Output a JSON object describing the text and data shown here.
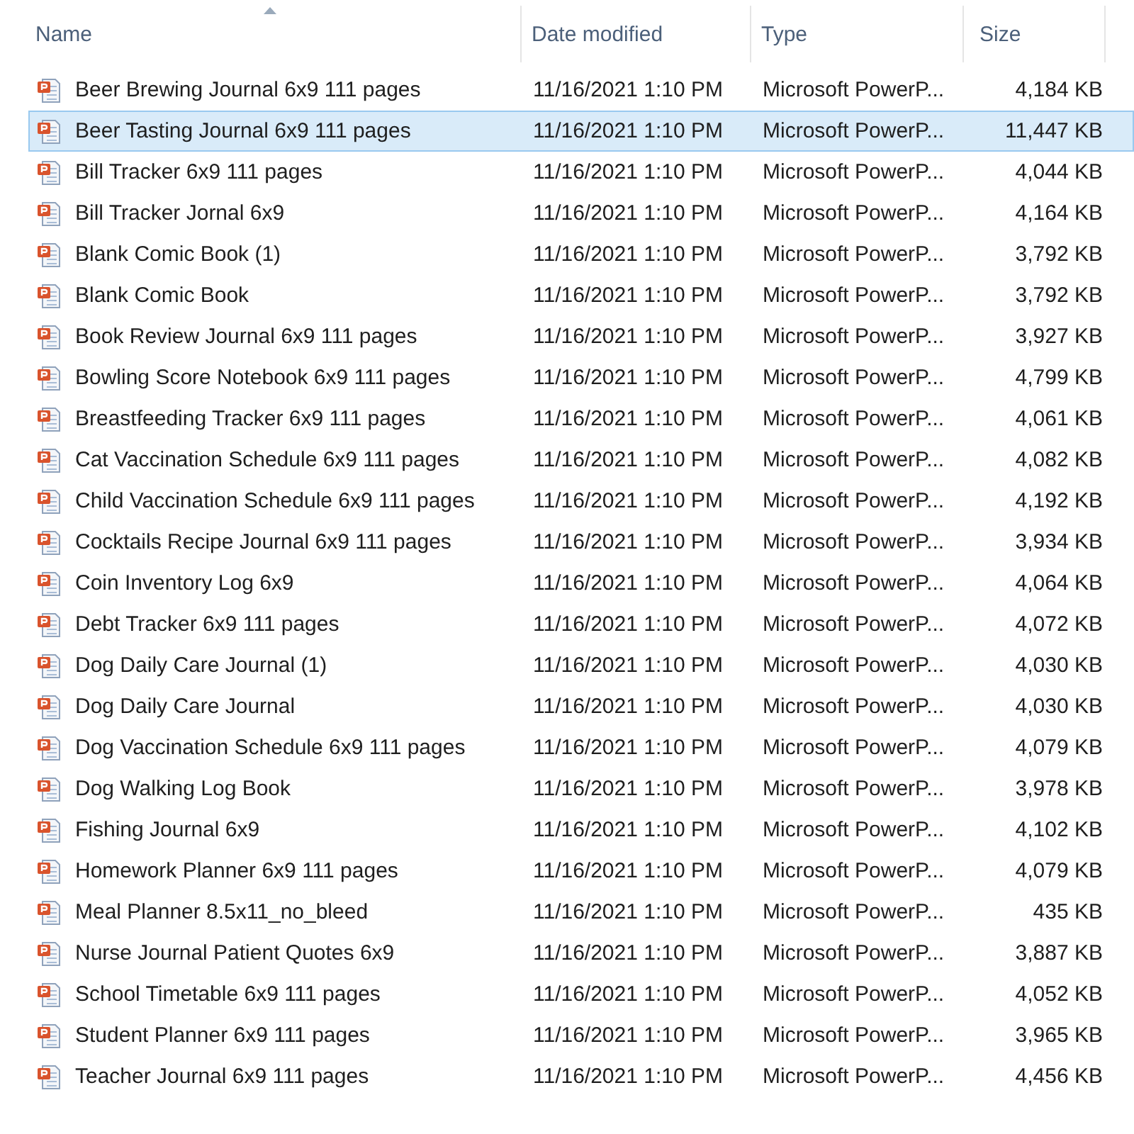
{
  "columns": [
    {
      "label": "Name",
      "sorted": true
    },
    {
      "label": "Date modified",
      "sorted": false
    },
    {
      "label": "Type",
      "sorted": false
    },
    {
      "label": "Size",
      "sorted": false
    }
  ],
  "rows": [
    {
      "name": "Beer Brewing Journal 6x9 111 pages",
      "date": "11/16/2021 1:10 PM",
      "type": "Microsoft PowerP...",
      "size": "4,184 KB",
      "selected": false
    },
    {
      "name": "Beer Tasting Journal 6x9 111 pages",
      "date": "11/16/2021 1:10 PM",
      "type": "Microsoft PowerP...",
      "size": "11,447 KB",
      "selected": true
    },
    {
      "name": "Bill Tracker 6x9 111 pages",
      "date": "11/16/2021 1:10 PM",
      "type": "Microsoft PowerP...",
      "size": "4,044 KB",
      "selected": false
    },
    {
      "name": "Bill Tracker Jornal 6x9",
      "date": "11/16/2021 1:10 PM",
      "type": "Microsoft PowerP...",
      "size": "4,164 KB",
      "selected": false
    },
    {
      "name": "Blank Comic Book (1)",
      "date": "11/16/2021 1:10 PM",
      "type": "Microsoft PowerP...",
      "size": "3,792 KB",
      "selected": false
    },
    {
      "name": "Blank Comic Book",
      "date": "11/16/2021 1:10 PM",
      "type": "Microsoft PowerP...",
      "size": "3,792 KB",
      "selected": false
    },
    {
      "name": "Book Review Journal 6x9 111 pages",
      "date": "11/16/2021 1:10 PM",
      "type": "Microsoft PowerP...",
      "size": "3,927 KB",
      "selected": false
    },
    {
      "name": "Bowling Score Notebook 6x9 111 pages",
      "date": "11/16/2021 1:10 PM",
      "type": "Microsoft PowerP...",
      "size": "4,799 KB",
      "selected": false
    },
    {
      "name": "Breastfeeding Tracker 6x9 111 pages",
      "date": "11/16/2021 1:10 PM",
      "type": "Microsoft PowerP...",
      "size": "4,061 KB",
      "selected": false
    },
    {
      "name": "Cat Vaccination Schedule 6x9 111 pages",
      "date": "11/16/2021 1:10 PM",
      "type": "Microsoft PowerP...",
      "size": "4,082 KB",
      "selected": false
    },
    {
      "name": "Child Vaccination Schedule 6x9 111 pages",
      "date": "11/16/2021 1:10 PM",
      "type": "Microsoft PowerP...",
      "size": "4,192 KB",
      "selected": false
    },
    {
      "name": "Cocktails Recipe Journal 6x9 111 pages",
      "date": "11/16/2021 1:10 PM",
      "type": "Microsoft PowerP...",
      "size": "3,934 KB",
      "selected": false
    },
    {
      "name": "Coin Inventory Log 6x9",
      "date": "11/16/2021 1:10 PM",
      "type": "Microsoft PowerP...",
      "size": "4,064 KB",
      "selected": false
    },
    {
      "name": "Debt Tracker 6x9 111 pages",
      "date": "11/16/2021 1:10 PM",
      "type": "Microsoft PowerP...",
      "size": "4,072 KB",
      "selected": false
    },
    {
      "name": "Dog Daily Care Journal (1)",
      "date": "11/16/2021 1:10 PM",
      "type": "Microsoft PowerP...",
      "size": "4,030 KB",
      "selected": false
    },
    {
      "name": "Dog Daily Care Journal",
      "date": "11/16/2021 1:10 PM",
      "type": "Microsoft PowerP...",
      "size": "4,030 KB",
      "selected": false
    },
    {
      "name": "Dog Vaccination Schedule 6x9 111 pages",
      "date": "11/16/2021 1:10 PM",
      "type": "Microsoft PowerP...",
      "size": "4,079 KB",
      "selected": false
    },
    {
      "name": "Dog Walking Log Book",
      "date": "11/16/2021 1:10 PM",
      "type": "Microsoft PowerP...",
      "size": "3,978 KB",
      "selected": false
    },
    {
      "name": "Fishing Journal 6x9",
      "date": "11/16/2021 1:10 PM",
      "type": "Microsoft PowerP...",
      "size": "4,102 KB",
      "selected": false
    },
    {
      "name": "Homework Planner 6x9 111 pages",
      "date": "11/16/2021 1:10 PM",
      "type": "Microsoft PowerP...",
      "size": "4,079 KB",
      "selected": false
    },
    {
      "name": "Meal Planner 8.5x11_no_bleed",
      "date": "11/16/2021 1:10 PM",
      "type": "Microsoft PowerP...",
      "size": "435 KB",
      "selected": false
    },
    {
      "name": "Nurse Journal Patient Quotes 6x9",
      "date": "11/16/2021 1:10 PM",
      "type": "Microsoft PowerP...",
      "size": "3,887 KB",
      "selected": false
    },
    {
      "name": "School Timetable 6x9 111 pages",
      "date": "11/16/2021 1:10 PM",
      "type": "Microsoft PowerP...",
      "size": "4,052 KB",
      "selected": false
    },
    {
      "name": "Student Planner 6x9 111 pages",
      "date": "11/16/2021 1:10 PM",
      "type": "Microsoft PowerP...",
      "size": "3,965 KB",
      "selected": false
    },
    {
      "name": "Teacher Journal 6x9 111 pages",
      "date": "11/16/2021 1:10 PM",
      "type": "Microsoft PowerP...",
      "size": "4,456 KB",
      "selected": false
    }
  ]
}
